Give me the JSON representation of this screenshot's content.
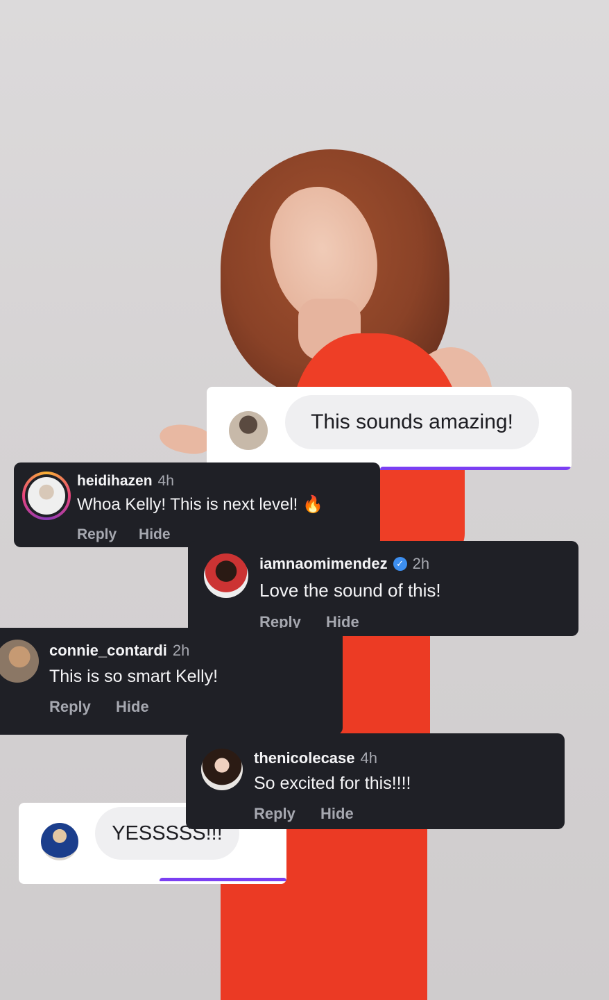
{
  "comments": {
    "card1": {
      "text": "This sounds amazing!"
    },
    "heidi": {
      "username": "heidihazen",
      "time": "4h",
      "text": "Whoa Kelly! This is next level! 🔥",
      "reply": "Reply",
      "hide": "Hide"
    },
    "naomi": {
      "username": "iamnaomimendez",
      "time": "2h",
      "text": "Love the sound of this!",
      "reply": "Reply",
      "hide": "Hide",
      "verified": true
    },
    "connie": {
      "username": "connie_contardi",
      "time": "2h",
      "text": "This is so smart Kelly!",
      "reply": "Reply",
      "hide": "Hide"
    },
    "nicole": {
      "username": "thenicolecase",
      "time": "4h",
      "text": "So excited for this!!!!",
      "reply": "Reply",
      "hide": "Hide"
    },
    "card2": {
      "text": "YESSSSS!!!"
    }
  },
  "colors": {
    "dark_card": "#1f2026",
    "accent_bar": "#7b3ff2",
    "dress": "#ec3b24",
    "verified": "#3d8ff0",
    "muted_text": "#a6a8b0"
  },
  "icons": [
    "verified-badge-icon",
    "fire-emoji"
  ]
}
